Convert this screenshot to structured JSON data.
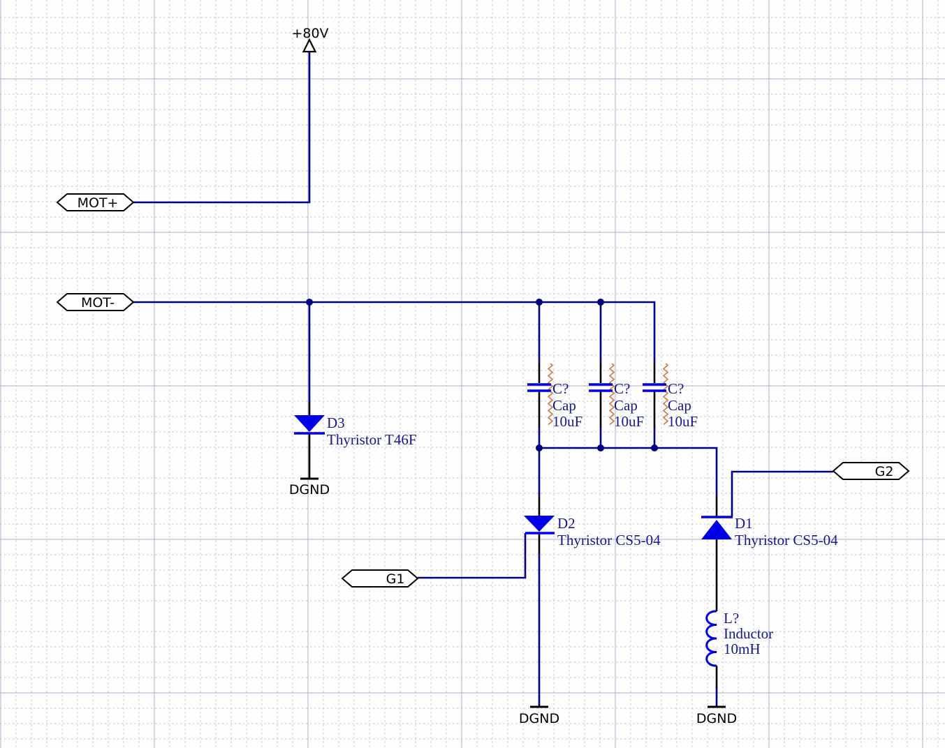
{
  "power": {
    "vcc": "+80V",
    "gnd_d3": "DGND",
    "gnd_d2": "DGND",
    "gnd_l": "DGND"
  },
  "ports": {
    "mot_plus": "MOT+",
    "mot_minus": "MOT-",
    "g1": "G1",
    "g2": "G2"
  },
  "components": {
    "d3": {
      "designator": "D3",
      "comment": "Thyristor T46F"
    },
    "d2": {
      "designator": "D2",
      "comment": "Thyristor CS5-04"
    },
    "d1": {
      "designator": "D1",
      "comment": "Thyristor CS5-04"
    },
    "c1": {
      "designator": "C?",
      "comment": "Cap",
      "value": "10uF"
    },
    "c2": {
      "designator": "C?",
      "comment": "Cap",
      "value": "10uF"
    },
    "c3": {
      "designator": "C?",
      "comment": "Cap",
      "value": "10uF"
    },
    "l1": {
      "designator": "L?",
      "comment": "Inductor",
      "value": "10mH"
    }
  },
  "colors": {
    "wire": "#000082",
    "component": "#0000e8",
    "component_label": "#16168e",
    "error_squiggle": "#cc7a4a",
    "grid_minor": "#c8c8d8",
    "grid_major": "#b0b0ce",
    "port_fill": "#ffffff",
    "port_stroke": "#000000"
  }
}
